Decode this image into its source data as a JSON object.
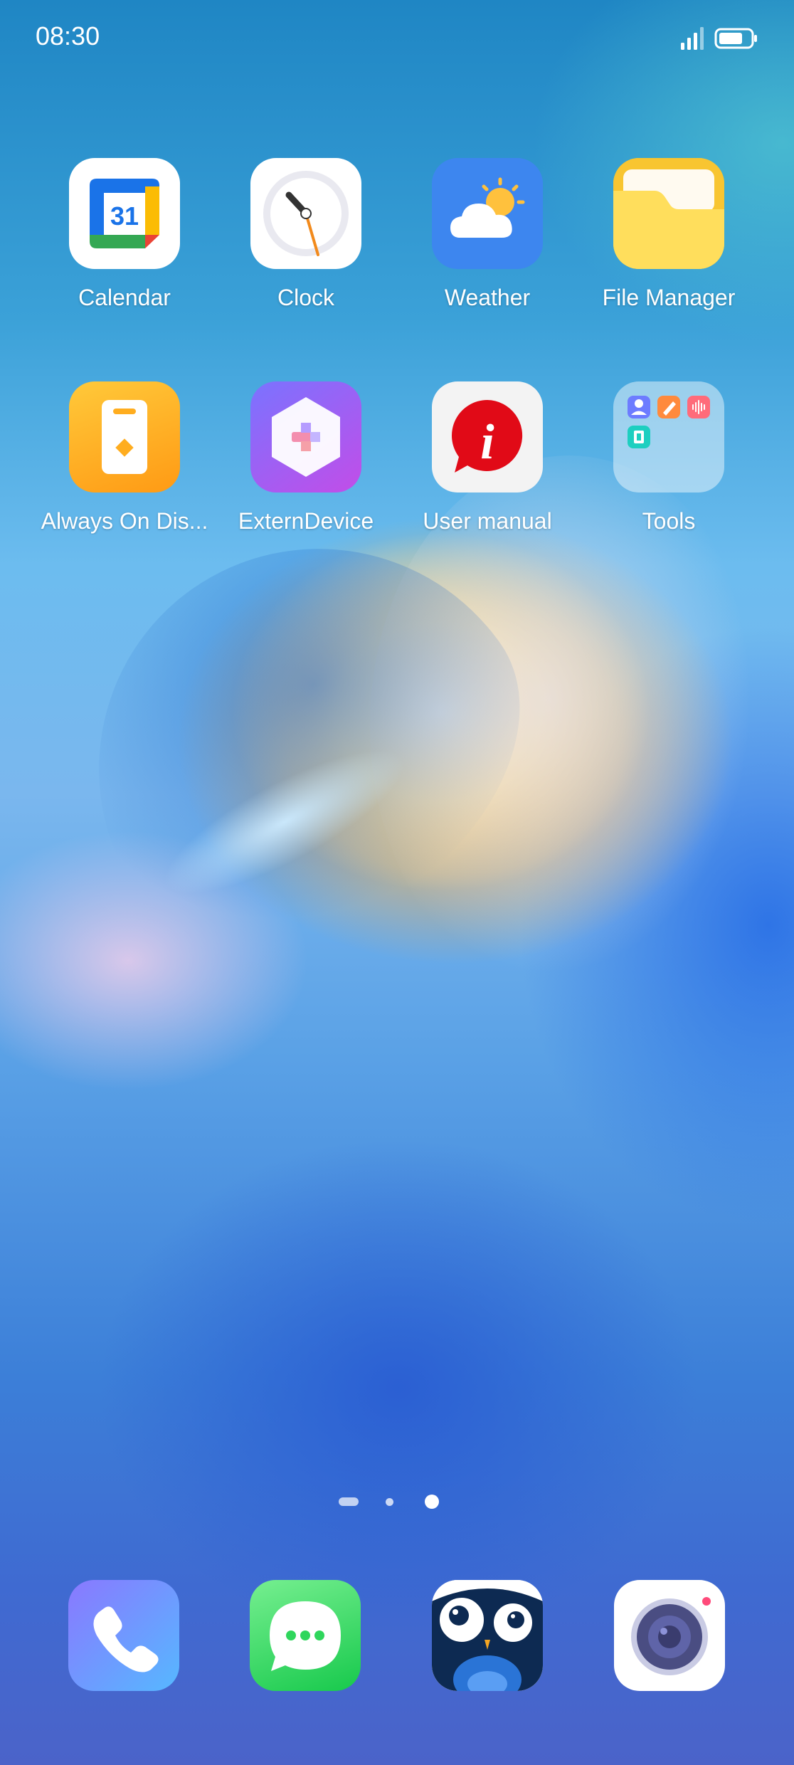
{
  "status_bar": {
    "time": "08:30",
    "signal_icon": "cellular-signal-icon",
    "battery_icon": "battery-icon"
  },
  "home": {
    "apps": [
      {
        "label": "Calendar",
        "icon": "calendar-icon"
      },
      {
        "label": "Clock",
        "icon": "clock-icon"
      },
      {
        "label": "Weather",
        "icon": "weather-icon"
      },
      {
        "label": "File Manager",
        "icon": "folder-icon"
      },
      {
        "label": "Always On Dis...",
        "icon": "always-on-display-icon"
      },
      {
        "label": "ExternDevice",
        "icon": "gamepad-icon"
      },
      {
        "label": "User manual",
        "icon": "info-icon"
      },
      {
        "label": "Tools",
        "icon": "folder-tools-icon"
      }
    ],
    "calendar_date": "31"
  },
  "page_indicator": {
    "pages": 3,
    "active_page": 3
  },
  "dock": {
    "apps": [
      {
        "name": "Phone",
        "icon": "phone-icon"
      },
      {
        "name": "Messages",
        "icon": "messages-icon"
      },
      {
        "name": "Owl app",
        "icon": "owl-icon"
      },
      {
        "name": "Camera",
        "icon": "camera-icon"
      }
    ]
  },
  "colors": {
    "calendar_blue": "#1a73e8",
    "weather_bg": "#3d86ef",
    "folder_yellow": "#ffd84d",
    "aod_orange": "#ffad1f",
    "manual_red": "#e10a17",
    "phone_bg": "#7b8cff",
    "messages_green": "#2fd65c"
  }
}
